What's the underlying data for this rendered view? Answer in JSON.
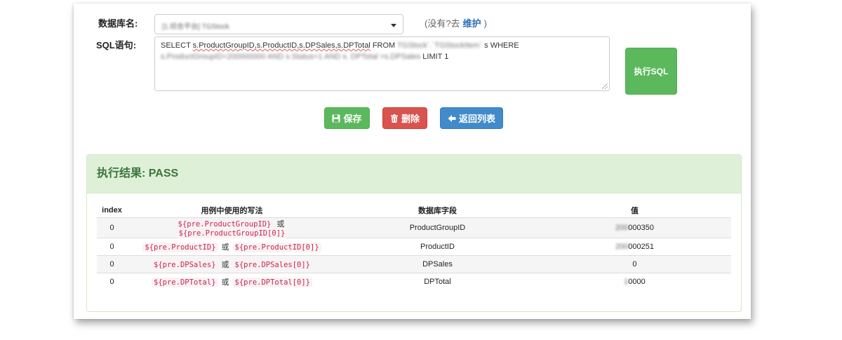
{
  "form": {
    "db_label": "数据库名:",
    "db_value": "[1.综合平台] TGStock",
    "hint_prefix": "(没有?去",
    "hint_link": "维护",
    "hint_suffix": ")",
    "sql_label": "SQL语句:",
    "sql": {
      "p1": "SELECT ",
      "p2_underlined": "s.ProductGroupID,s.ProductID,s.DPSales,s.DPTotal",
      "p3": " FROM ",
      "p4_blurred": "TGStock`.`TGStockItem`",
      "p5": " s WHERE",
      "p6_blurred": "s.ProductGroupID=200000000 AND s.Status=1 AND s. DPTotal >s.DPSales",
      "p7": " LIMIT 1"
    },
    "execute_label": "执行SQL"
  },
  "actions": {
    "save": "保存",
    "delete": "删除",
    "back": "返回列表"
  },
  "result": {
    "title": "执行结果: PASS",
    "headers": [
      "index",
      "用例中使用的写法",
      "数据库字段",
      "值"
    ],
    "or_text": "或",
    "rows": [
      {
        "index": "0",
        "expr": "${pre.ProductGroupID}",
        "expr_idx": "${pre.ProductGroupID[0]}",
        "field": "ProductGroupID",
        "value_hidden": "200",
        "value": "000350"
      },
      {
        "index": "0",
        "expr": "${pre.ProductID}",
        "expr_idx": "${pre.ProductID[0]}",
        "field": "ProductID",
        "value_hidden": "200",
        "value": "000251"
      },
      {
        "index": "0",
        "expr": "${pre.DPSales}",
        "expr_idx": "${pre.DPSales[0]}",
        "field": "DPSales",
        "value_hidden": "",
        "value": "0"
      },
      {
        "index": "0",
        "expr": "${pre.DPTotal}",
        "expr_idx": "${pre.DPTotal[0]}",
        "field": "DPTotal",
        "value_hidden": "1",
        "value": "0000"
      }
    ]
  },
  "colors": {
    "success": "#5cb85c",
    "danger": "#d9534f",
    "primary": "#428bca",
    "result_header_bg": "#dff0d8",
    "result_header_text": "#3c763d",
    "code_text": "#c7254e"
  }
}
